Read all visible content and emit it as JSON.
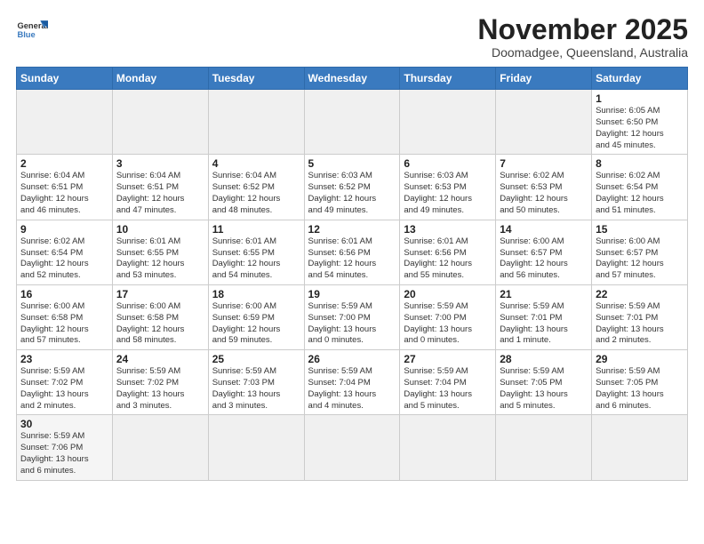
{
  "header": {
    "logo_line1": "General",
    "logo_line2": "Blue",
    "month_title": "November 2025",
    "subtitle": "Doomadgee, Queensland, Australia"
  },
  "weekdays": [
    "Sunday",
    "Monday",
    "Tuesday",
    "Wednesday",
    "Thursday",
    "Friday",
    "Saturday"
  ],
  "weeks": [
    [
      {
        "day": "",
        "info": ""
      },
      {
        "day": "",
        "info": ""
      },
      {
        "day": "",
        "info": ""
      },
      {
        "day": "",
        "info": ""
      },
      {
        "day": "",
        "info": ""
      },
      {
        "day": "",
        "info": ""
      },
      {
        "day": "1",
        "info": "Sunrise: 6:05 AM\nSunset: 6:50 PM\nDaylight: 12 hours\nand 45 minutes."
      }
    ],
    [
      {
        "day": "2",
        "info": "Sunrise: 6:04 AM\nSunset: 6:51 PM\nDaylight: 12 hours\nand 46 minutes."
      },
      {
        "day": "3",
        "info": "Sunrise: 6:04 AM\nSunset: 6:51 PM\nDaylight: 12 hours\nand 47 minutes."
      },
      {
        "day": "4",
        "info": "Sunrise: 6:04 AM\nSunset: 6:52 PM\nDaylight: 12 hours\nand 48 minutes."
      },
      {
        "day": "5",
        "info": "Sunrise: 6:03 AM\nSunset: 6:52 PM\nDaylight: 12 hours\nand 49 minutes."
      },
      {
        "day": "6",
        "info": "Sunrise: 6:03 AM\nSunset: 6:53 PM\nDaylight: 12 hours\nand 49 minutes."
      },
      {
        "day": "7",
        "info": "Sunrise: 6:02 AM\nSunset: 6:53 PM\nDaylight: 12 hours\nand 50 minutes."
      },
      {
        "day": "8",
        "info": "Sunrise: 6:02 AM\nSunset: 6:54 PM\nDaylight: 12 hours\nand 51 minutes."
      }
    ],
    [
      {
        "day": "9",
        "info": "Sunrise: 6:02 AM\nSunset: 6:54 PM\nDaylight: 12 hours\nand 52 minutes."
      },
      {
        "day": "10",
        "info": "Sunrise: 6:01 AM\nSunset: 6:55 PM\nDaylight: 12 hours\nand 53 minutes."
      },
      {
        "day": "11",
        "info": "Sunrise: 6:01 AM\nSunset: 6:55 PM\nDaylight: 12 hours\nand 54 minutes."
      },
      {
        "day": "12",
        "info": "Sunrise: 6:01 AM\nSunset: 6:56 PM\nDaylight: 12 hours\nand 54 minutes."
      },
      {
        "day": "13",
        "info": "Sunrise: 6:01 AM\nSunset: 6:56 PM\nDaylight: 12 hours\nand 55 minutes."
      },
      {
        "day": "14",
        "info": "Sunrise: 6:00 AM\nSunset: 6:57 PM\nDaylight: 12 hours\nand 56 minutes."
      },
      {
        "day": "15",
        "info": "Sunrise: 6:00 AM\nSunset: 6:57 PM\nDaylight: 12 hours\nand 57 minutes."
      }
    ],
    [
      {
        "day": "16",
        "info": "Sunrise: 6:00 AM\nSunset: 6:58 PM\nDaylight: 12 hours\nand 57 minutes."
      },
      {
        "day": "17",
        "info": "Sunrise: 6:00 AM\nSunset: 6:58 PM\nDaylight: 12 hours\nand 58 minutes."
      },
      {
        "day": "18",
        "info": "Sunrise: 6:00 AM\nSunset: 6:59 PM\nDaylight: 12 hours\nand 59 minutes."
      },
      {
        "day": "19",
        "info": "Sunrise: 5:59 AM\nSunset: 7:00 PM\nDaylight: 13 hours\nand 0 minutes."
      },
      {
        "day": "20",
        "info": "Sunrise: 5:59 AM\nSunset: 7:00 PM\nDaylight: 13 hours\nand 0 minutes."
      },
      {
        "day": "21",
        "info": "Sunrise: 5:59 AM\nSunset: 7:01 PM\nDaylight: 13 hours\nand 1 minute."
      },
      {
        "day": "22",
        "info": "Sunrise: 5:59 AM\nSunset: 7:01 PM\nDaylight: 13 hours\nand 2 minutes."
      }
    ],
    [
      {
        "day": "23",
        "info": "Sunrise: 5:59 AM\nSunset: 7:02 PM\nDaylight: 13 hours\nand 2 minutes."
      },
      {
        "day": "24",
        "info": "Sunrise: 5:59 AM\nSunset: 7:02 PM\nDaylight: 13 hours\nand 3 minutes."
      },
      {
        "day": "25",
        "info": "Sunrise: 5:59 AM\nSunset: 7:03 PM\nDaylight: 13 hours\nand 3 minutes."
      },
      {
        "day": "26",
        "info": "Sunrise: 5:59 AM\nSunset: 7:04 PM\nDaylight: 13 hours\nand 4 minutes."
      },
      {
        "day": "27",
        "info": "Sunrise: 5:59 AM\nSunset: 7:04 PM\nDaylight: 13 hours\nand 5 minutes."
      },
      {
        "day": "28",
        "info": "Sunrise: 5:59 AM\nSunset: 7:05 PM\nDaylight: 13 hours\nand 5 minutes."
      },
      {
        "day": "29",
        "info": "Sunrise: 5:59 AM\nSunset: 7:05 PM\nDaylight: 13 hours\nand 6 minutes."
      }
    ],
    [
      {
        "day": "30",
        "info": "Sunrise: 5:59 AM\nSunset: 7:06 PM\nDaylight: 13 hours\nand 6 minutes."
      },
      {
        "day": "",
        "info": ""
      },
      {
        "day": "",
        "info": ""
      },
      {
        "day": "",
        "info": ""
      },
      {
        "day": "",
        "info": ""
      },
      {
        "day": "",
        "info": ""
      },
      {
        "day": "",
        "info": ""
      }
    ]
  ]
}
